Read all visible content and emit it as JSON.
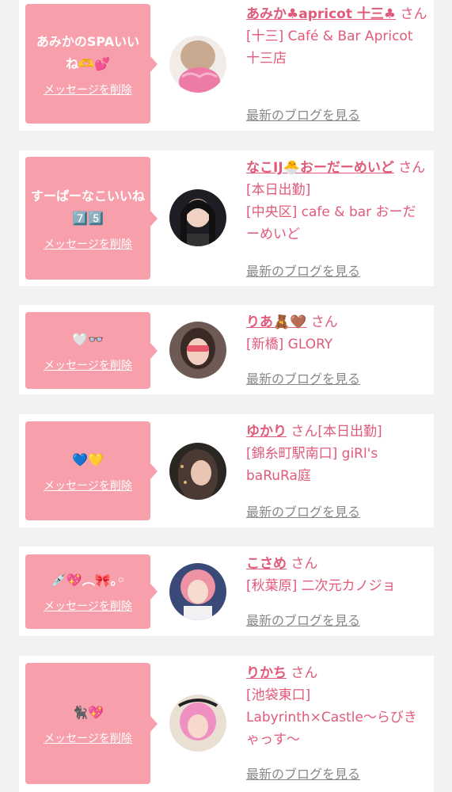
{
  "delete_label": "メッセージを削除",
  "blog_label": "最新のブログを見る",
  "san": "さん",
  "cards": [
    {
      "message": "あみかのSPAいいね🫶💕",
      "name": "あみか♣apricot 十三♣",
      "status": "",
      "shop": "[十三] Café & Bar Apricot 十三店"
    },
    {
      "message": "すーぱーなこいいね7️⃣5️⃣",
      "name": "なこIJ🐣おーだーめいど",
      "status": "[本日出勤]",
      "shop": "[中央区] cafe & bar おーだーめいど"
    },
    {
      "message": "🤍👓",
      "name": "りあ🧸🤎",
      "status": "",
      "shop": "[新橋] GLORY"
    },
    {
      "message": "💙💛",
      "name": "ゆかり",
      "status": "[本日出勤]",
      "shop": "[錦糸町駅南口] giRl's baRuRa庭"
    },
    {
      "message": "💉💖︵🎀｡◦",
      "name": "こさめ",
      "status": "",
      "shop": "[秋葉原] 二次元カノジョ"
    },
    {
      "message": "🐈‍⬛💖",
      "name": "りかち",
      "status": "",
      "shop": "[池袋東口] Labyrinth×Castle〜らびきゃっす〜"
    }
  ]
}
